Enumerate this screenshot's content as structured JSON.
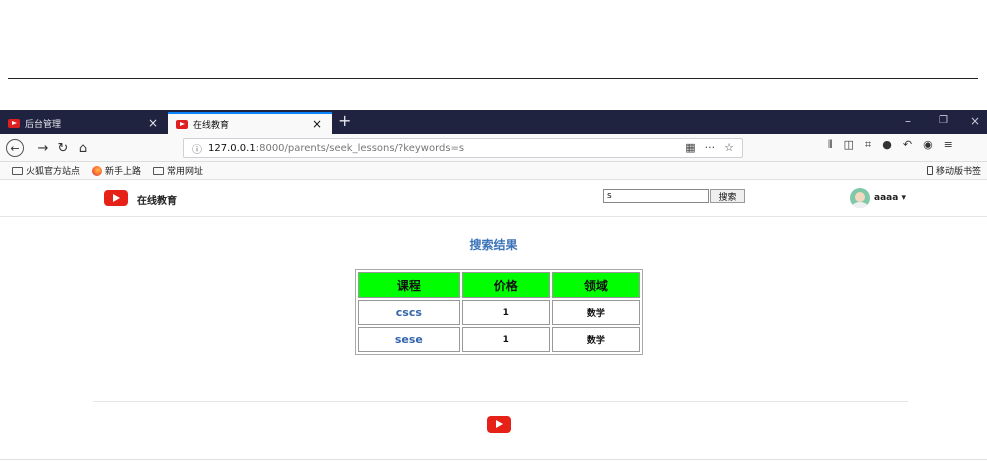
{
  "browser": {
    "tabs": [
      {
        "label": "后台管理",
        "active": false
      },
      {
        "label": "在线教育",
        "active": true
      }
    ],
    "new_tab_icon": "+",
    "url_host": "127.0.0.1",
    "url_rest": ":8000/parents/seek_lessons/?keywords=s",
    "bookmarks": [
      "火狐官方站点",
      "新手上路",
      "常用网址"
    ],
    "mobile_bookmarks": "移动版书签",
    "accent_color": "#0a84ff"
  },
  "site": {
    "title": "在线教育",
    "search_value": "s",
    "search_button": "搜索",
    "username": "aaaa",
    "brand_color": "#e62117"
  },
  "results": {
    "title": "搜索结果",
    "headers": [
      "课程",
      "价格",
      "领域"
    ],
    "header_color": "#00ff00",
    "rows": [
      {
        "course": "cscs",
        "price": "1",
        "domain": "数学"
      },
      {
        "course": "sese",
        "price": "1",
        "domain": "数学"
      }
    ]
  }
}
